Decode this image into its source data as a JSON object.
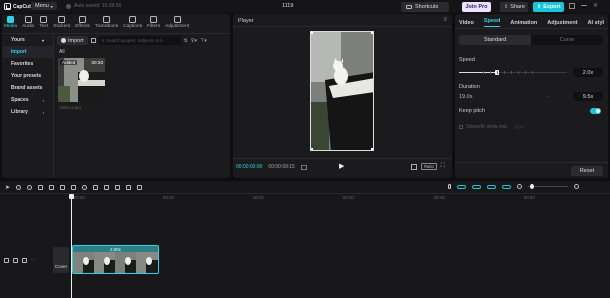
{
  "app": {
    "name": "CapCut",
    "menu_label": "Menu",
    "autosave": "Auto saved: 16:38:56",
    "project_title": "1119",
    "shortcuts_label": "Shortcuts",
    "join_pro_label": "Join Pro",
    "share_label": "Share",
    "export_label": "Export"
  },
  "media_tabs": [
    {
      "label": "Media",
      "icon": "media-icon"
    },
    {
      "label": "Audio",
      "icon": "audio-icon"
    },
    {
      "label": "Text",
      "icon": "text-icon"
    },
    {
      "label": "Stickers",
      "icon": "stickers-icon"
    },
    {
      "label": "Effects",
      "icon": "effects-icon"
    },
    {
      "label": "Transitions",
      "icon": "transitions-icon"
    },
    {
      "label": "Captions",
      "icon": "captions-icon"
    },
    {
      "label": "Filters",
      "icon": "filters-icon"
    },
    {
      "label": "Adjustment",
      "icon": "adjustment-icon"
    }
  ],
  "sidebar": {
    "items": [
      {
        "label": "Yours"
      },
      {
        "label": "Import"
      },
      {
        "label": "Favorites"
      },
      {
        "label": "Your presets"
      },
      {
        "label": "Brand assets"
      },
      {
        "label": "Spaces"
      },
      {
        "label": "Library"
      }
    ]
  },
  "media": {
    "import_label": "Import",
    "search_placeholder": "Search project, subjects in li...",
    "filter_all": "All",
    "clip": {
      "badge": "Added",
      "duration": "00:20",
      "filename": "Video.mp4"
    }
  },
  "player": {
    "title": "Player",
    "current_time": "00:00:00:00",
    "total_time": "00:00:09:15",
    "ratio_label": "Ratio"
  },
  "properties": {
    "tabs": [
      {
        "label": "Video"
      },
      {
        "label": "Speed"
      },
      {
        "label": "Animation"
      },
      {
        "label": "Adjustment"
      },
      {
        "label": "AI styl"
      }
    ],
    "mode_standard": "Standard",
    "mode_curve": "Curve",
    "speed_label": "Speed",
    "speed_value": "2.0x",
    "speed_fraction": 0.35,
    "duration_label": "Duration",
    "duration_from": "19.0s",
    "duration_to": "9.5s",
    "keep_pitch_label": "Keep pitch",
    "keep_pitch_on": true,
    "smooth_slow_label": "Smooth slow-mo",
    "reset_label": "Reset"
  },
  "timeline": {
    "ticks": [
      "00:00",
      "00:10",
      "00:20",
      "00:30",
      "00:40",
      "00:50"
    ],
    "clip_label": "2.00x",
    "cover_label": "Cover"
  },
  "colors": {
    "accent": "#19c5d8",
    "pro_bg": "#e9e3ff"
  }
}
